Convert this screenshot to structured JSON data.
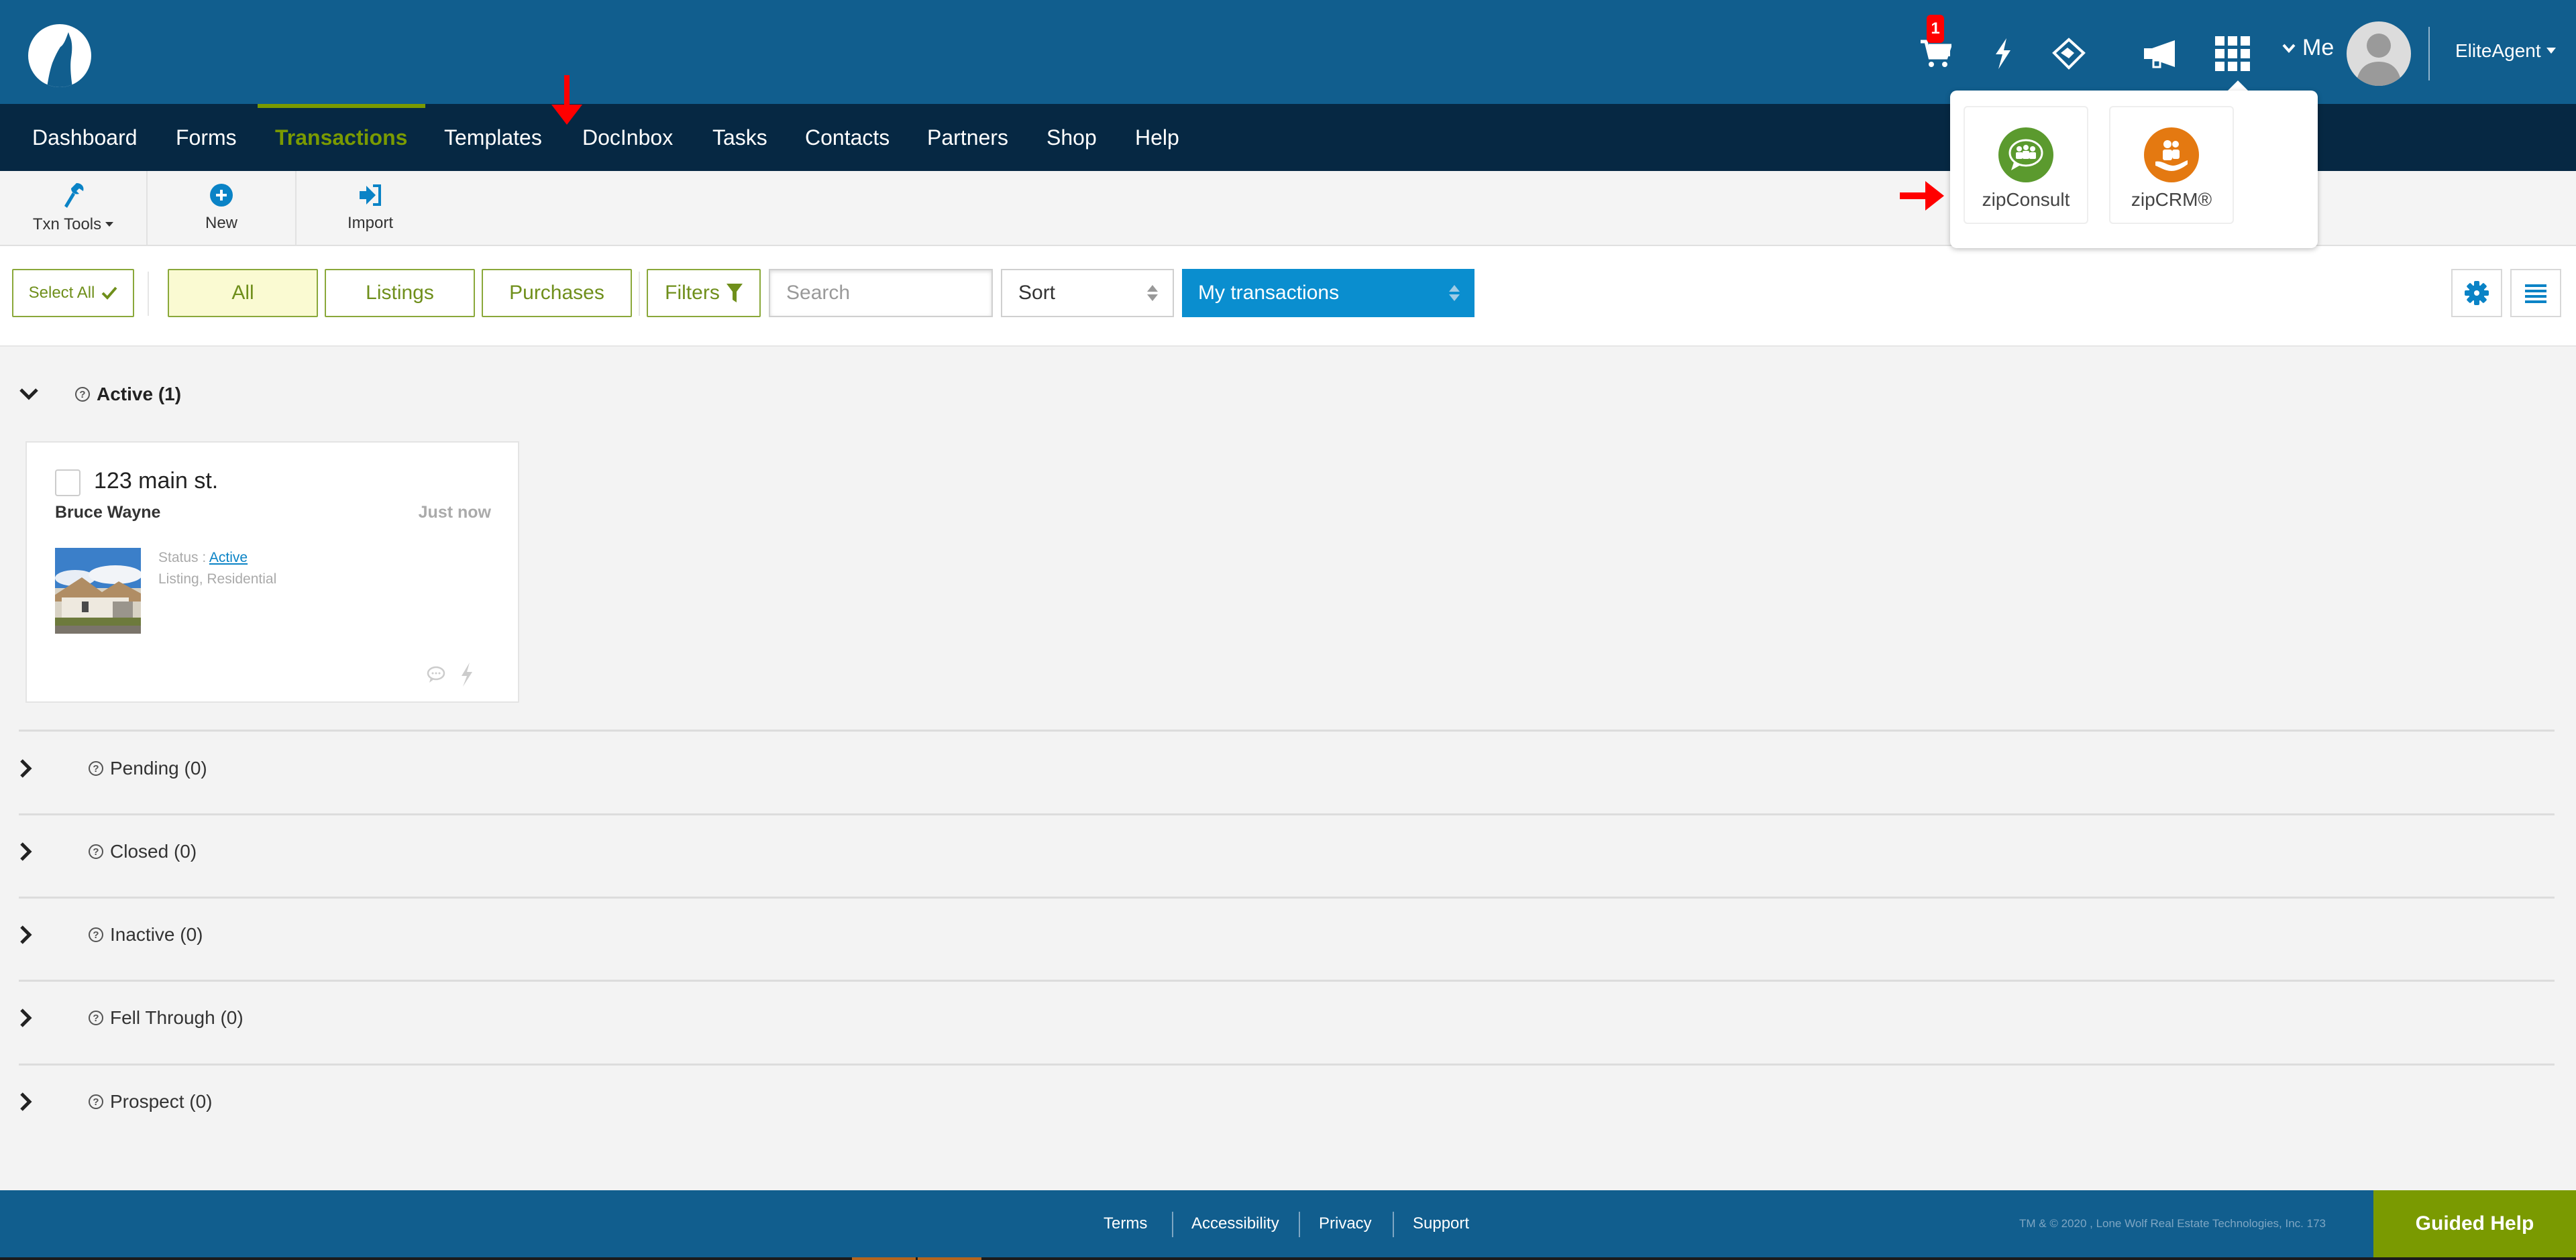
{
  "header": {
    "logo": "lone-wolf-logo",
    "cart_badge": "1",
    "icons": [
      "cart-icon",
      "lightning-icon",
      "handshake-icon",
      "megaphone-icon",
      "apps-grid-icon"
    ],
    "me_label": "Me",
    "account_label": "EliteAgent"
  },
  "nav": {
    "items": [
      {
        "label": "Dashboard"
      },
      {
        "label": "Forms"
      },
      {
        "label": "Transactions",
        "active": true
      },
      {
        "label": "Templates"
      },
      {
        "label": "DocInbox"
      },
      {
        "label": "Tasks"
      },
      {
        "label": "Contacts"
      },
      {
        "label": "Partners"
      },
      {
        "label": "Shop"
      },
      {
        "label": "Help"
      }
    ],
    "active_color": "#7a9a01"
  },
  "toolbar": {
    "txn_tools_label": "Txn Tools",
    "new_label": "New",
    "import_label": "Import"
  },
  "filters": {
    "select_all_label": "Select All",
    "tabs": [
      {
        "label": "All",
        "selected": true
      },
      {
        "label": "Listings"
      },
      {
        "label": "Purchases"
      }
    ],
    "filters_label": "Filters",
    "search_placeholder": "Search",
    "sort_value": "Sort",
    "scope_value": "My transactions"
  },
  "sections": [
    {
      "label": "Active (1)",
      "expanded": true
    },
    {
      "label": "Pending (0)"
    },
    {
      "label": "Closed (0)"
    },
    {
      "label": "Inactive (0)"
    },
    {
      "label": "Fell Through (0)"
    },
    {
      "label": "Prospect (0)"
    }
  ],
  "card": {
    "title": "123 main st.",
    "client": "Bruce Wayne",
    "time": "Just now",
    "status_label": "Status :",
    "status_value": "Active",
    "type": "Listing, Residential"
  },
  "apps_dropdown": {
    "apps": [
      {
        "label": "zipConsult",
        "color": "#5b9a2e"
      },
      {
        "label": "zipCRM®",
        "color": "#e47911"
      }
    ]
  },
  "footer": {
    "links": [
      "Terms",
      "Accessibility",
      "Privacy",
      "Support"
    ],
    "copyright": "TM & © 2020 , Lone Wolf Real Estate Technologies, Inc. 173",
    "guided_help_label": "Guided Help"
  },
  "colors": {
    "header_blue": "#115e8e",
    "nav_dark": "#062843",
    "accent_green": "#7a9a01",
    "primary_blue": "#0a8ecf",
    "annotation_red": "#ff0000"
  }
}
